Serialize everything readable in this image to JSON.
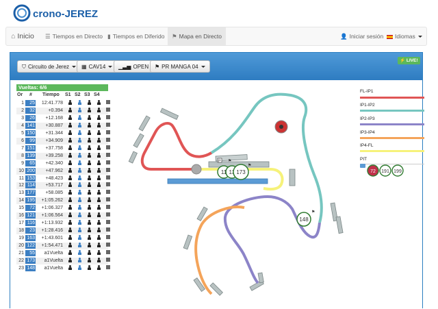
{
  "brand": {
    "name": "crono-JEREZ"
  },
  "nav": {
    "home": "Inicio",
    "live_times": "Tiempos en Directo",
    "deferred_times": "Tiempos en Diferido",
    "live_map": "Mapa en Directo",
    "login": "Iniciar sesión",
    "languages": "Idiomas"
  },
  "toolbar": {
    "circuit": "Circuito de Jerez",
    "category": "CAV14",
    "class": "OPEN",
    "session": "PR MANGA 04",
    "live_badge": "LIVE!"
  },
  "laps_label": "Vueltas: 6/6",
  "table": {
    "headers": [
      "Or",
      "#",
      "Tiempo",
      "S1",
      "S2",
      "S3",
      "S4"
    ],
    "rows": [
      {
        "or": "1",
        "num": "25",
        "time": "12:41.778"
      },
      {
        "or": "2",
        "num": "32",
        "time": "+0.394"
      },
      {
        "or": "3",
        "num": "26",
        "time": "+12.168"
      },
      {
        "or": "4",
        "num": "141",
        "time": "+30.887"
      },
      {
        "or": "5",
        "num": "150",
        "time": "+31.344"
      },
      {
        "or": "6",
        "num": "99",
        "time": "+34.909"
      },
      {
        "or": "7",
        "num": "151",
        "time": "+37.758"
      },
      {
        "or": "8",
        "num": "139",
        "time": "+39.258"
      },
      {
        "or": "9",
        "num": "65",
        "time": "+42.340"
      },
      {
        "or": "10",
        "num": "200",
        "time": "+47.962"
      },
      {
        "or": "11",
        "num": "153",
        "time": "+48.423"
      },
      {
        "or": "12",
        "num": "114",
        "time": "+53.717"
      },
      {
        "or": "13",
        "num": "177",
        "time": "+58.085"
      },
      {
        "or": "14",
        "num": "195",
        "time": "+1:05.262"
      },
      {
        "or": "15",
        "num": "72",
        "time": "+1:06.327"
      },
      {
        "or": "16",
        "num": "121",
        "time": "+1:06.564"
      },
      {
        "or": "17",
        "num": "116",
        "time": "+1:13.932"
      },
      {
        "or": "18",
        "num": "23",
        "time": "+1:28.416"
      },
      {
        "or": "19",
        "num": "163",
        "time": "+1:43.601"
      },
      {
        "or": "20",
        "num": "122",
        "time": "+1:54.471"
      },
      {
        "or": "21",
        "num": "55",
        "time": "a1Vuelta"
      },
      {
        "or": "22",
        "num": "173",
        "time": "a1Vuelta"
      },
      {
        "or": "23",
        "num": "148",
        "time": "a1Vuelta"
      }
    ]
  },
  "legend": {
    "items": [
      {
        "label": "FL-IP1",
        "color": "#e05555"
      },
      {
        "label": "IP1-IP2",
        "color": "#76c6c0"
      },
      {
        "label": "IP2-IP3",
        "color": "#8c84c8"
      },
      {
        "label": "IP3-IP4",
        "color": "#f4a45a"
      },
      {
        "label": "IP4-FL",
        "color": "#f6f27a"
      }
    ],
    "pit_label": "PIT",
    "pit_riders": [
      "72",
      "191",
      "199"
    ]
  },
  "map": {
    "riders": [
      "11",
      "13",
      "173",
      "148"
    ],
    "pit_sign": "P"
  },
  "colors": {
    "accent": "#2e7cc1",
    "live": "#5cb85c",
    "table_num": "#3c7fc3"
  }
}
